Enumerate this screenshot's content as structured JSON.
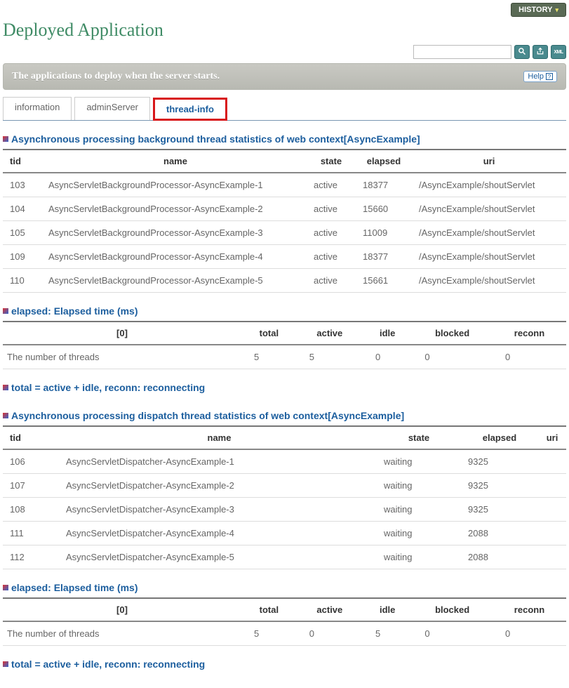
{
  "top": {
    "history": "HISTORY"
  },
  "page_title": "Deployed Application",
  "search_placeholder": "",
  "banner": {
    "text": "The applications to deploy when the server starts.",
    "help": "Help"
  },
  "tabs": [
    {
      "label": "information",
      "active": false
    },
    {
      "label": "adminServer",
      "active": false
    },
    {
      "label": "thread-info",
      "active": true
    }
  ],
  "sections": {
    "bg_title": "Asynchronous processing background thread statistics of web context[AsyncExample]",
    "bg_cols": [
      "tid",
      "name",
      "state",
      "elapsed",
      "uri"
    ],
    "bg_rows": [
      {
        "tid": "103",
        "name": "AsyncServletBackgroundProcessor-AsyncExample-1",
        "state": "active",
        "elapsed": "18377",
        "uri": "/AsyncExample/shoutServlet"
      },
      {
        "tid": "104",
        "name": "AsyncServletBackgroundProcessor-AsyncExample-2",
        "state": "active",
        "elapsed": "15660",
        "uri": "/AsyncExample/shoutServlet"
      },
      {
        "tid": "105",
        "name": "AsyncServletBackgroundProcessor-AsyncExample-3",
        "state": "active",
        "elapsed": "11009",
        "uri": "/AsyncExample/shoutServlet"
      },
      {
        "tid": "109",
        "name": "AsyncServletBackgroundProcessor-AsyncExample-4",
        "state": "active",
        "elapsed": "18377",
        "uri": "/AsyncExample/shoutServlet"
      },
      {
        "tid": "110",
        "name": "AsyncServletBackgroundProcessor-AsyncExample-5",
        "state": "active",
        "elapsed": "15661",
        "uri": "/AsyncExample/shoutServlet"
      }
    ],
    "elapsed_title": "elapsed: Elapsed time (ms)",
    "sum_cols": [
      "[0]",
      "total",
      "active",
      "idle",
      "blocked",
      "reconn"
    ],
    "sum_row_label": "The number of threads",
    "sum1": {
      "total": "5",
      "active": "5",
      "idle": "0",
      "blocked": "0",
      "reconn": "0"
    },
    "formula_title": "total = active + idle, reconn: reconnecting",
    "disp_title": "Asynchronous processing dispatch thread statistics of web context[AsyncExample]",
    "disp_cols": [
      "tid",
      "name",
      "state",
      "elapsed",
      "uri"
    ],
    "disp_rows": [
      {
        "tid": "106",
        "name": "AsyncServletDispatcher-AsyncExample-1",
        "state": "waiting",
        "elapsed": "9325"
      },
      {
        "tid": "107",
        "name": "AsyncServletDispatcher-AsyncExample-2",
        "state": "waiting",
        "elapsed": "9325"
      },
      {
        "tid": "108",
        "name": "AsyncServletDispatcher-AsyncExample-3",
        "state": "waiting",
        "elapsed": "9325"
      },
      {
        "tid": "111",
        "name": "AsyncServletDispatcher-AsyncExample-4",
        "state": "waiting",
        "elapsed": "2088"
      },
      {
        "tid": "112",
        "name": "AsyncServletDispatcher-AsyncExample-5",
        "state": "waiting",
        "elapsed": "2088"
      }
    ],
    "sum2": {
      "total": "5",
      "active": "0",
      "idle": "5",
      "blocked": "0",
      "reconn": "0"
    }
  }
}
